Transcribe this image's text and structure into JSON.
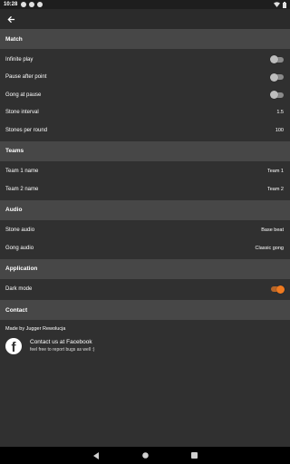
{
  "status_bar": {
    "time": "10:28"
  },
  "sections": {
    "match": {
      "title": "Match",
      "infinite_play": {
        "label": "Infinite play",
        "on": false
      },
      "pause_after_point": {
        "label": "Pause after point",
        "on": false
      },
      "gong_at_pause": {
        "label": "Gong at pause",
        "on": false
      },
      "stone_interval": {
        "label": "Stone interval",
        "value": "1.5"
      },
      "stones_per_round": {
        "label": "Stones per round",
        "value": "100"
      }
    },
    "teams": {
      "title": "Teams",
      "team1": {
        "label": "Team 1 name",
        "value": "Team 1"
      },
      "team2": {
        "label": "Team 2 name",
        "value": "Team 2"
      }
    },
    "audio": {
      "title": "Audio",
      "stone_audio": {
        "label": "Stone audio",
        "value": "Base beat"
      },
      "gong_audio": {
        "label": "Gong audio",
        "value": "Classic gong"
      }
    },
    "application": {
      "title": "Application",
      "dark_mode": {
        "label": "Dark mode",
        "on": true
      }
    },
    "contact": {
      "title": "Contact",
      "made_by": "Made by Jugger Rewolucja",
      "facebook_title": "Contact us at Facebook",
      "facebook_sub": "feel free to report bugs as well :)"
    }
  },
  "colors": {
    "background": "#303030",
    "section_header": "#474747",
    "accent": "#ef7a20"
  }
}
